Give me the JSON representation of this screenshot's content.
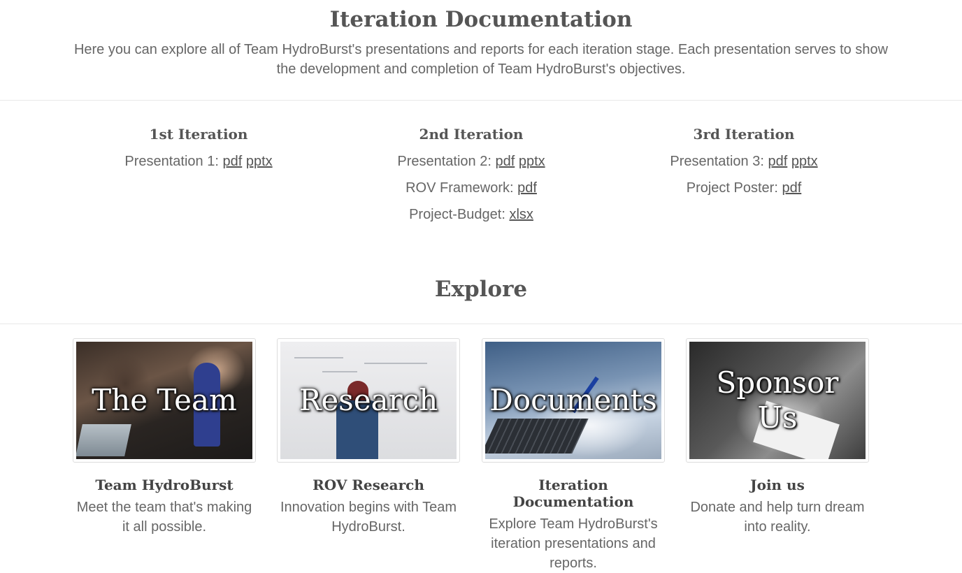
{
  "header": {
    "title": "Iteration Documentation",
    "intro": "Here you can explore all of Team HydroBurst's presentations and reports for each iteration stage. Each presentation serves to show the development and completion of Team HydroBurst's objectives."
  },
  "iterations": [
    {
      "title": "1st Iteration",
      "lines": [
        {
          "label": "Presentation 1: ",
          "links": [
            "pdf",
            "pptx"
          ]
        }
      ]
    },
    {
      "title": "2nd Iteration",
      "lines": [
        {
          "label": "Presentation 2: ",
          "links": [
            "pdf",
            "pptx"
          ]
        },
        {
          "label": "ROV Framework: ",
          "links": [
            "pdf"
          ]
        },
        {
          "label": "Project-Budget: ",
          "links": [
            "xlsx"
          ]
        }
      ]
    },
    {
      "title": "3rd Iteration",
      "lines": [
        {
          "label": "Presentation 3: ",
          "links": [
            "pdf",
            "pptx"
          ]
        },
        {
          "label": "Project Poster: ",
          "links": [
            "pdf"
          ]
        }
      ]
    }
  ],
  "explore": {
    "title": "Explore",
    "cards": [
      {
        "image_text": "The Team",
        "title": "Team HydroBurst",
        "desc": "Meet the team that's making it all possible."
      },
      {
        "image_text": "Research",
        "title": "ROV Research",
        "desc": "Innovation begins with Team HydroBurst."
      },
      {
        "image_text": "Documents",
        "title": "Iteration Documentation",
        "desc": "Explore Team HydroBurst's iteration presentations and reports."
      },
      {
        "image_text": "Sponsor Us",
        "title": "Join us",
        "desc": "Donate and help turn dream into reality."
      }
    ]
  }
}
